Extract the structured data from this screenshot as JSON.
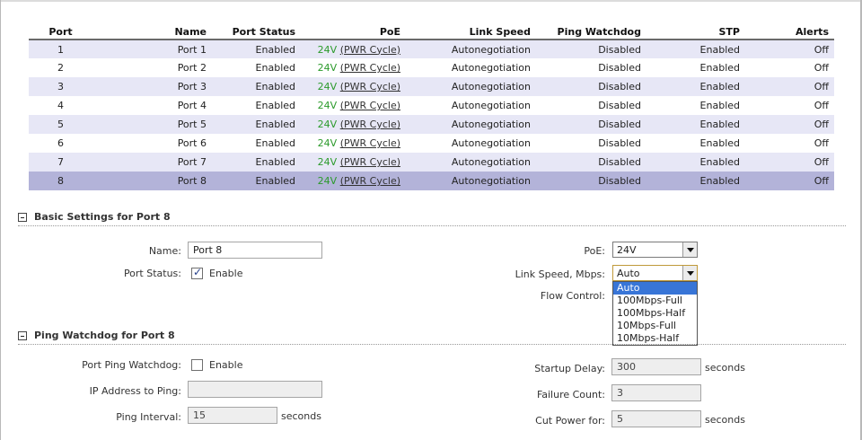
{
  "table": {
    "headers": [
      "Port",
      "Name",
      "Port Status",
      "PoE",
      "Link Speed",
      "Ping Watchdog",
      "STP",
      "Alerts"
    ],
    "rows": [
      {
        "port": "1",
        "name": "Port 1",
        "status": "Enabled",
        "poe": "24V",
        "pwr": "(PWR Cycle)",
        "link": "Autonegotiation",
        "ping": "Disabled",
        "stp": "Enabled",
        "alerts": "Off"
      },
      {
        "port": "2",
        "name": "Port 2",
        "status": "Enabled",
        "poe": "24V",
        "pwr": "(PWR Cycle)",
        "link": "Autonegotiation",
        "ping": "Disabled",
        "stp": "Enabled",
        "alerts": "Off"
      },
      {
        "port": "3",
        "name": "Port 3",
        "status": "Enabled",
        "poe": "24V",
        "pwr": "(PWR Cycle)",
        "link": "Autonegotiation",
        "ping": "Disabled",
        "stp": "Enabled",
        "alerts": "Off"
      },
      {
        "port": "4",
        "name": "Port 4",
        "status": "Enabled",
        "poe": "24V",
        "pwr": "(PWR Cycle)",
        "link": "Autonegotiation",
        "ping": "Disabled",
        "stp": "Enabled",
        "alerts": "Off"
      },
      {
        "port": "5",
        "name": "Port 5",
        "status": "Enabled",
        "poe": "24V",
        "pwr": "(PWR Cycle)",
        "link": "Autonegotiation",
        "ping": "Disabled",
        "stp": "Enabled",
        "alerts": "Off"
      },
      {
        "port": "6",
        "name": "Port 6",
        "status": "Enabled",
        "poe": "24V",
        "pwr": "(PWR Cycle)",
        "link": "Autonegotiation",
        "ping": "Disabled",
        "stp": "Enabled",
        "alerts": "Off"
      },
      {
        "port": "7",
        "name": "Port 7",
        "status": "Enabled",
        "poe": "24V",
        "pwr": "(PWR Cycle)",
        "link": "Autonegotiation",
        "ping": "Disabled",
        "stp": "Enabled",
        "alerts": "Off"
      },
      {
        "port": "8",
        "name": "Port 8",
        "status": "Enabled",
        "poe": "24V",
        "pwr": "(PWR Cycle)",
        "link": "Autonegotiation",
        "ping": "Disabled",
        "stp": "Enabled",
        "alerts": "Off"
      }
    ],
    "selected_row": "8"
  },
  "basic": {
    "title": "Basic Settings for Port 8",
    "name_label": "Name:",
    "name_value": "Port 8",
    "status_label": "Port Status:",
    "status_checked": true,
    "status_cb_label": "Enable",
    "poe_label": "PoE:",
    "poe_value": "24V",
    "link_label": "Link Speed, Mbps:",
    "link_value": "Auto",
    "flow_label": "Flow Control:",
    "link_options": [
      "Auto",
      "100Mbps-Full",
      "100Mbps-Half",
      "10Mbps-Full",
      "10Mbps-Half"
    ]
  },
  "ping": {
    "title": "Ping Watchdog for Port 8",
    "watchdog_label": "Port Ping Watchdog:",
    "watchdog_checked": false,
    "watchdog_cb_label": "Enable",
    "ip_label": "IP Address to Ping:",
    "ip_value": "",
    "interval_label": "Ping Interval:",
    "interval_value": "15",
    "interval_unit": "seconds",
    "startup_label": "Startup Delay:",
    "startup_value": "300",
    "startup_unit": "seconds",
    "failure_label": "Failure Count:",
    "failure_value": "3",
    "cut_label": "Cut Power for:",
    "cut_value": "5",
    "cut_unit": "seconds"
  },
  "colors": {
    "row_odd": "#e7e7f6",
    "row_selected": "#b3b3d9",
    "poe_green": "#2b9a2b",
    "dropdown_highlight": "#3875d7"
  }
}
